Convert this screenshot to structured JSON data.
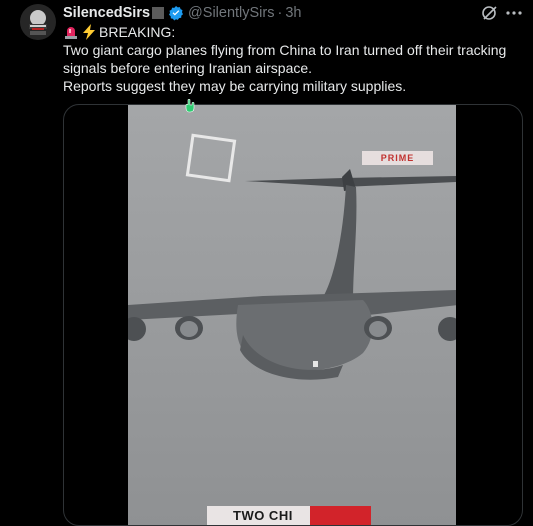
{
  "author": {
    "name": "SilencedSirs",
    "handle": "@SilentlySirs",
    "separator": "·",
    "time": "3h"
  },
  "post": {
    "heading": "BREAKING:",
    "line1": "Two giant cargo planes flying from China to Iran turned off their tracking",
    "line2": "signals before entering Iranian airspace.",
    "line3": "Reports suggest they may be carrying military supplies."
  },
  "video": {
    "watermark": "PRIME",
    "caption": "TWO CHI"
  },
  "icons": [
    "avatar",
    "verified-badge-icon",
    "grok-icon",
    "more-options-icon",
    "siren-emoji-icon",
    "lightning-emoji-icon",
    "cursor-icon"
  ],
  "colors": {
    "background": "#000000",
    "text": "#e7e9ea",
    "muted": "#71767b",
    "verified": "#1d9bf0",
    "border": "#2f3336",
    "accent_red": "#d2232a"
  }
}
